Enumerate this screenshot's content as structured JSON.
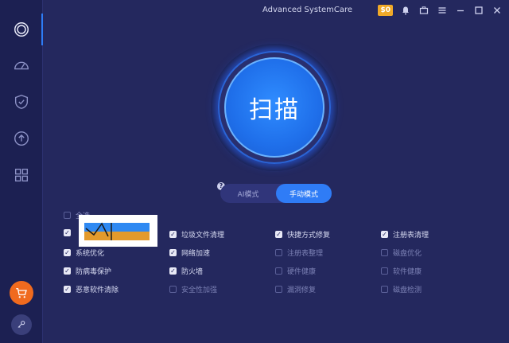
{
  "app": {
    "title": "Advanced SystemCare",
    "badge": "$0"
  },
  "scan": {
    "label": "扫描"
  },
  "modes": {
    "ai": "AI模式",
    "manual": "手动模式",
    "help": "?"
  },
  "select_all": {
    "label": "全选"
  },
  "options": [
    {
      "label": "",
      "checked": true
    },
    {
      "label": "垃圾文件清理",
      "checked": true
    },
    {
      "label": "快捷方式修复",
      "checked": true
    },
    {
      "label": "注册表清理",
      "checked": true
    },
    {
      "label": "系统优化",
      "checked": true
    },
    {
      "label": "网络加速",
      "checked": true
    },
    {
      "label": "注册表整理",
      "checked": false
    },
    {
      "label": "磁盘优化",
      "checked": false
    },
    {
      "label": "防病毒保护",
      "checked": true
    },
    {
      "label": "防火墙",
      "checked": true
    },
    {
      "label": "硬件健康",
      "checked": false
    },
    {
      "label": "软件健康",
      "checked": false
    },
    {
      "label": "恶意软件清除",
      "checked": true
    },
    {
      "label": "安全性加强",
      "checked": false
    },
    {
      "label": "漏洞修复",
      "checked": false
    },
    {
      "label": "磁盘检测",
      "checked": false
    }
  ],
  "colors": {
    "accent": "#2f7cf6",
    "background": "#24285e",
    "sidebar": "#1c2052",
    "cart": "#f06a1e"
  }
}
